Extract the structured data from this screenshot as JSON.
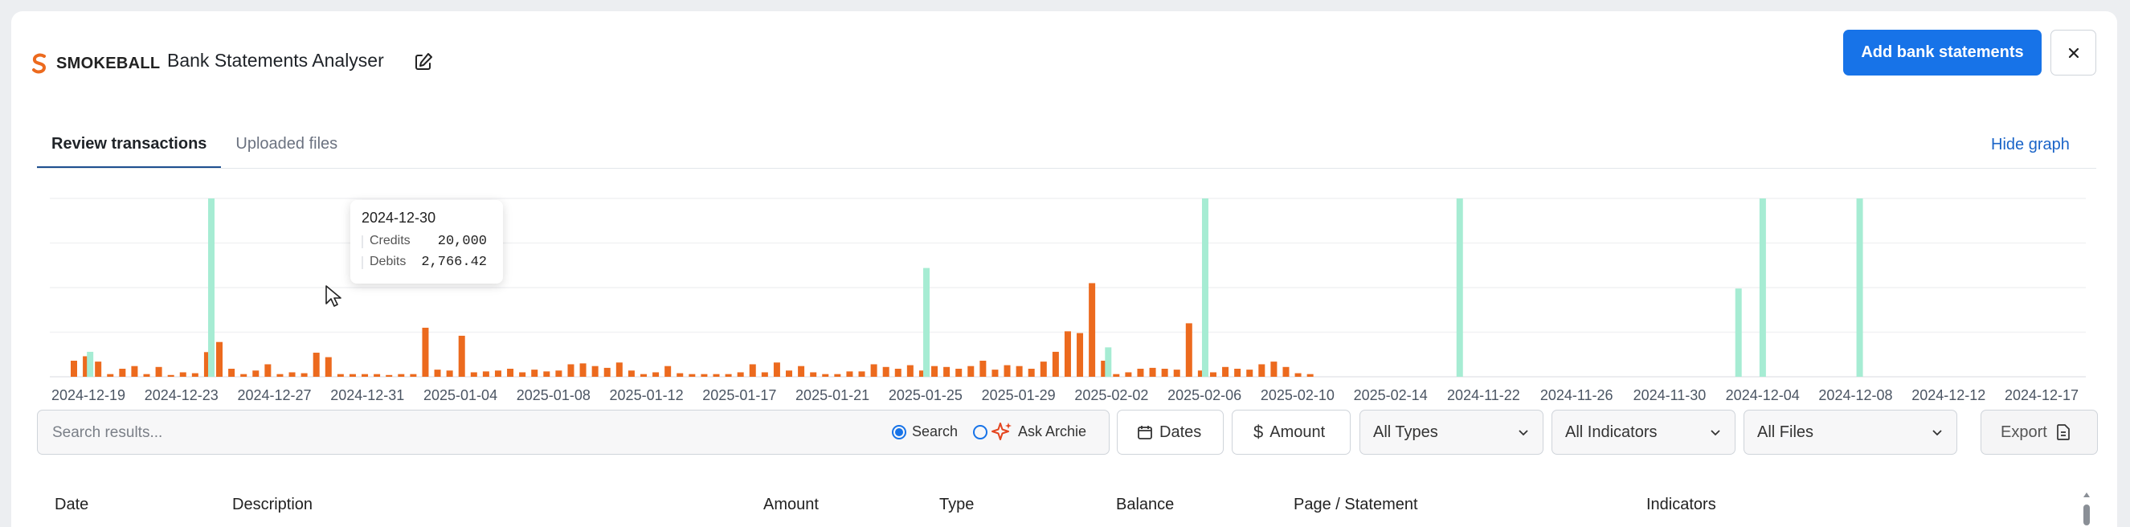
{
  "header": {
    "logo_text": "SMOKEBALL",
    "title": "Bank Statements Analyser",
    "add_button": "Add bank statements",
    "icons": {
      "logo": "smokeball-logo-icon",
      "edit": "pencil-square-icon",
      "close": "close-icon"
    }
  },
  "tabs": [
    {
      "label": "Review transactions",
      "active": true
    },
    {
      "label": "Uploaded files",
      "active": false
    }
  ],
  "hide_graph": "Hide graph",
  "colors": {
    "credits": "#a6ecd3",
    "debits": "#ec6a1e",
    "accent": "#1773e8"
  },
  "chart_data": {
    "type": "bar",
    "x_ticks": [
      "2024-12-19",
      "2024-12-23",
      "2024-12-27",
      "2024-12-31",
      "2025-01-04",
      "2025-01-08",
      "2025-01-12",
      "2025-01-17",
      "2025-01-21",
      "2025-01-25",
      "2025-01-29",
      "2025-02-02",
      "2025-02-06",
      "2025-02-10",
      "2025-02-14",
      "2024-11-22",
      "2024-11-26",
      "2024-11-30",
      "2024-12-04",
      "2024-12-08",
      "2024-12-12",
      "2024-12-17"
    ],
    "ylim": [
      0,
      20000
    ],
    "grid": true,
    "series": [
      {
        "name": "Credits",
        "values": [
          0,
          0,
          2800,
          0,
          0,
          0,
          0,
          0,
          0,
          0,
          0,
          0,
          20000,
          0,
          0,
          0,
          0,
          0,
          0,
          0,
          0,
          0,
          0,
          0,
          0,
          0,
          0,
          0,
          0,
          0,
          0,
          0,
          0,
          0,
          0,
          0,
          0,
          0,
          0,
          0,
          0,
          0,
          0,
          0,
          0,
          0,
          0,
          0,
          0,
          0,
          0,
          0,
          0,
          0,
          0,
          0,
          0,
          0,
          0,
          0,
          0,
          0,
          0,
          0,
          0,
          0,
          0,
          0,
          0,
          0,
          0,
          12200,
          0,
          0,
          0,
          0,
          0,
          0,
          0,
          0,
          0,
          0,
          0,
          0,
          0,
          0,
          3300,
          0,
          0,
          0,
          0,
          0,
          0,
          0,
          20000,
          0,
          0,
          0,
          0,
          0,
          0,
          0,
          0,
          0,
          0,
          0,
          0,
          0,
          0,
          0,
          0,
          0,
          0,
          0,
          0,
          20000,
          0,
          0,
          0,
          0,
          0,
          0,
          0,
          0,
          0,
          0,
          0,
          0,
          0,
          0,
          0,
          0,
          0,
          0,
          0,
          0,
          0,
          0,
          9900,
          0,
          20000,
          0,
          0,
          0,
          0,
          0,
          0,
          0,
          20000,
          0,
          0,
          0,
          0,
          0,
          0,
          0,
          0,
          0,
          0,
          0,
          0,
          0,
          0,
          0,
          0,
          0
        ]
      },
      {
        "name": "Debits",
        "values": [
          1800,
          2300,
          1700,
          300,
          900,
          1200,
          300,
          1100,
          200,
          500,
          400,
          2766.42,
          3900,
          900,
          300,
          700,
          1400,
          300,
          500,
          400,
          2700,
          2200,
          300,
          300,
          300,
          300,
          200,
          300,
          300,
          5500,
          800,
          700,
          4600,
          500,
          600,
          700,
          900,
          500,
          800,
          600,
          700,
          1400,
          1500,
          1200,
          1000,
          1600,
          700,
          300,
          500,
          1200,
          400,
          300,
          300,
          300,
          300,
          500,
          1400,
          500,
          1600,
          700,
          1200,
          500,
          300,
          300,
          600,
          600,
          1400,
          1100,
          900,
          1300,
          700,
          1200,
          1100,
          900,
          1200,
          1800,
          800,
          1300,
          1200,
          900,
          1700,
          2800,
          5100,
          4900,
          10500,
          1800,
          300,
          500,
          900,
          1000,
          900,
          800,
          6000,
          700,
          500,
          1100,
          900,
          800,
          1400,
          1700,
          1100,
          400,
          300
        ]
      }
    ]
  },
  "tooltip": {
    "date": "2024-12-30",
    "credits_label": "Credits",
    "credits_value": "20,000",
    "debits_label": "Debits",
    "debits_value": "2,766.42"
  },
  "filters": {
    "search_placeholder": "Search results...",
    "mode_search": "Search",
    "mode_archie": "Ask Archie",
    "dates": "Dates",
    "amount": "Amount",
    "types": "All Types",
    "indicators": "All Indicators",
    "files": "All Files",
    "export": "Export"
  },
  "table": {
    "headers": [
      "Date",
      "Description",
      "Amount",
      "Type",
      "Balance",
      "Page / Statement",
      "Indicators"
    ]
  }
}
